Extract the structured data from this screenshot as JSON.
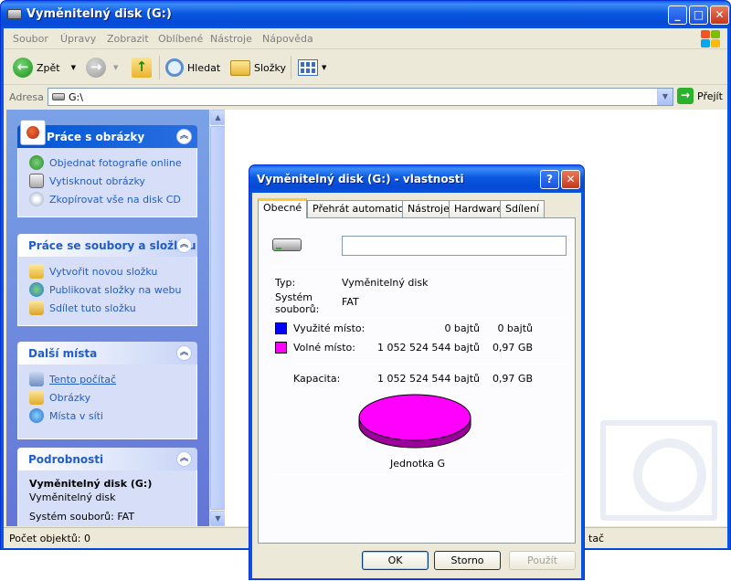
{
  "explorer": {
    "title": "Vyměnitelný disk (G:)",
    "menu": [
      "Soubor",
      "Úpravy",
      "Zobrazit",
      "Oblíbené",
      "Nástroje",
      "Nápověda"
    ],
    "toolbar": {
      "back_label": "Zpět",
      "search_label": "Hledat",
      "folders_label": "Složky"
    },
    "address": {
      "label": "Adresa",
      "value": "G:\\",
      "go_label": "Přejít"
    },
    "taskpane": {
      "picture_tasks": {
        "title": "Práce s obrázky",
        "items": [
          "Objednat fotografie online",
          "Vytisknout obrázky",
          "Zkopírovat vše na disk CD"
        ]
      },
      "file_tasks": {
        "title": "Práce se soubory a složkou",
        "items": [
          "Vytvořit novou složku",
          "Publikovat složky na webu",
          "Sdílet tuto složku"
        ]
      },
      "other_places": {
        "title": "Další místa",
        "items": [
          "Tento počítač",
          "Obrázky",
          "Místa v síti"
        ]
      },
      "details": {
        "title": "Podrobnosti",
        "name": "Vyměnitelný disk (G:)",
        "type": "Vyměnitelný disk",
        "filesystem": "Systém souborů: FAT"
      }
    },
    "status": {
      "left": "Počet objektů: 0",
      "right": "tač"
    }
  },
  "dialog": {
    "title": "Vyměnitelný disk (G:) - vlastnosti",
    "tabs": [
      "Obecné",
      "Přehrát automaticky",
      "Nástroje",
      "Hardware",
      "Sdílení"
    ],
    "label_value": "",
    "type_label": "Typ:",
    "type_value": "Vyměnitelný disk",
    "fs_label_1": "Systém",
    "fs_label_2": "souborů:",
    "fs_value": "FAT",
    "used": {
      "label": "Využité místo:",
      "bytes": "0 bajtů",
      "short": "0 bajtů",
      "color": "#0000ff"
    },
    "free": {
      "label": "Volné místo:",
      "bytes": "1 052 524 544 bajtů",
      "short": "0,97 GB",
      "color": "#ff00ff"
    },
    "capacity": {
      "label": "Kapacita:",
      "bytes": "1 052 524 544 bajtů",
      "short": "0,97 GB"
    },
    "drive_label": "Jednotka G",
    "buttons": {
      "ok": "OK",
      "cancel": "Storno",
      "apply": "Použít"
    }
  },
  "colors": {
    "xp_blue": "#0a54e3",
    "task_link": "#215dc6",
    "pie_free": "#ff00ff",
    "pie_free_side": "#9c009c"
  }
}
